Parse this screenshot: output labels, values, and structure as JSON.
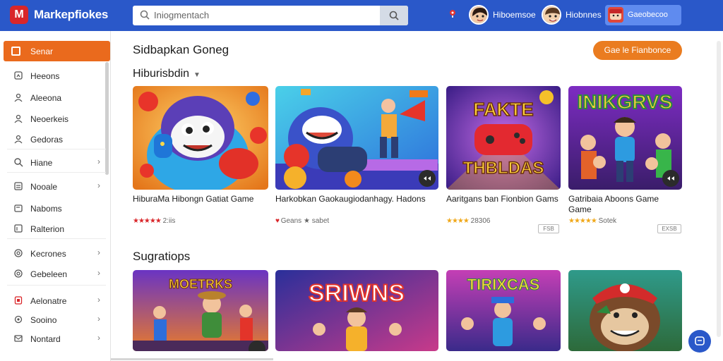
{
  "app": {
    "logo_letter": "M",
    "name": "Markepfiokes",
    "brand_color": "#2a58c9",
    "accent": "#ea6a1d"
  },
  "search": {
    "value": "Iniogmentach"
  },
  "users": [
    {
      "name": "Hiboemsoe"
    },
    {
      "name": "Hiobnnes"
    }
  ],
  "account_button": {
    "label": "Gaeobecoo"
  },
  "sidebar": {
    "active": {
      "label": "Senar",
      "icon": "grid-icon"
    },
    "items": [
      {
        "label": "Heeons",
        "icon": "home-icon",
        "chevron": false
      },
      {
        "label": "Aleeona",
        "icon": "user-icon",
        "chevron": false
      },
      {
        "label": "Neoerkeis",
        "icon": "user-icon",
        "chevron": false
      },
      {
        "label": "Gedoras",
        "icon": "user-icon",
        "chevron": false
      },
      {
        "label": "Hiane",
        "icon": "search-icon",
        "chevron": true
      },
      {
        "label": "Nooale",
        "icon": "list-icon",
        "chevron": true
      },
      {
        "label": "Naboms",
        "icon": "card-icon",
        "chevron": false
      },
      {
        "label": "Ralterion",
        "icon": "tag-icon",
        "chevron": false
      },
      {
        "label": "Kecrones",
        "icon": "settings-icon",
        "chevron": true
      },
      {
        "label": "Gebeleen",
        "icon": "settings-icon",
        "chevron": true
      },
      {
        "label": "Aelonatre",
        "icon": "lock-icon",
        "chevron": true
      },
      {
        "label": "Sooino",
        "icon": "gear-icon",
        "chevron": true
      },
      {
        "label": "Nontard",
        "icon": "mail-icon",
        "chevron": true
      }
    ]
  },
  "main": {
    "heading": "Sidbapkan Goneg",
    "cta_label": "Gae le Fianbonce",
    "section1": {
      "title": "Hiburisbdin",
      "cards": [
        {
          "title": "HiburaMa Hibongn Gatiat Game",
          "stars": "★★★★★",
          "star_color": "red",
          "rating": "2:iis",
          "badge": ""
        },
        {
          "title": "Harkobkan Gaokaugiodanhagy. Hadons",
          "stars": "♥",
          "star_color": "red",
          "rating": "Geans ★ sabet",
          "badge": ""
        },
        {
          "title": "Aaritgans ban Fionbion Gams",
          "stars": "★★★★",
          "star_color": "gold",
          "rating": "28306",
          "badge": "FSB"
        },
        {
          "title": "Gatribaia Aboons Game Game",
          "stars": "★★★★★",
          "star_color": "gold",
          "rating": "Sotek",
          "badge": "EXSB"
        }
      ]
    },
    "section2": {
      "title": "Sugratiops",
      "cards": [
        {
          "art_text": "MOETRKS"
        },
        {
          "art_text": "SRIWNS"
        },
        {
          "art_text": "TIRIXCAS"
        },
        {
          "art_text": ""
        }
      ]
    },
    "card1_art": {
      "art_text": ""
    },
    "card3_art": {
      "art_text": "FAKTE THBLDAS"
    },
    "card4_art": {
      "art_text": "INIKGRVS"
    }
  }
}
